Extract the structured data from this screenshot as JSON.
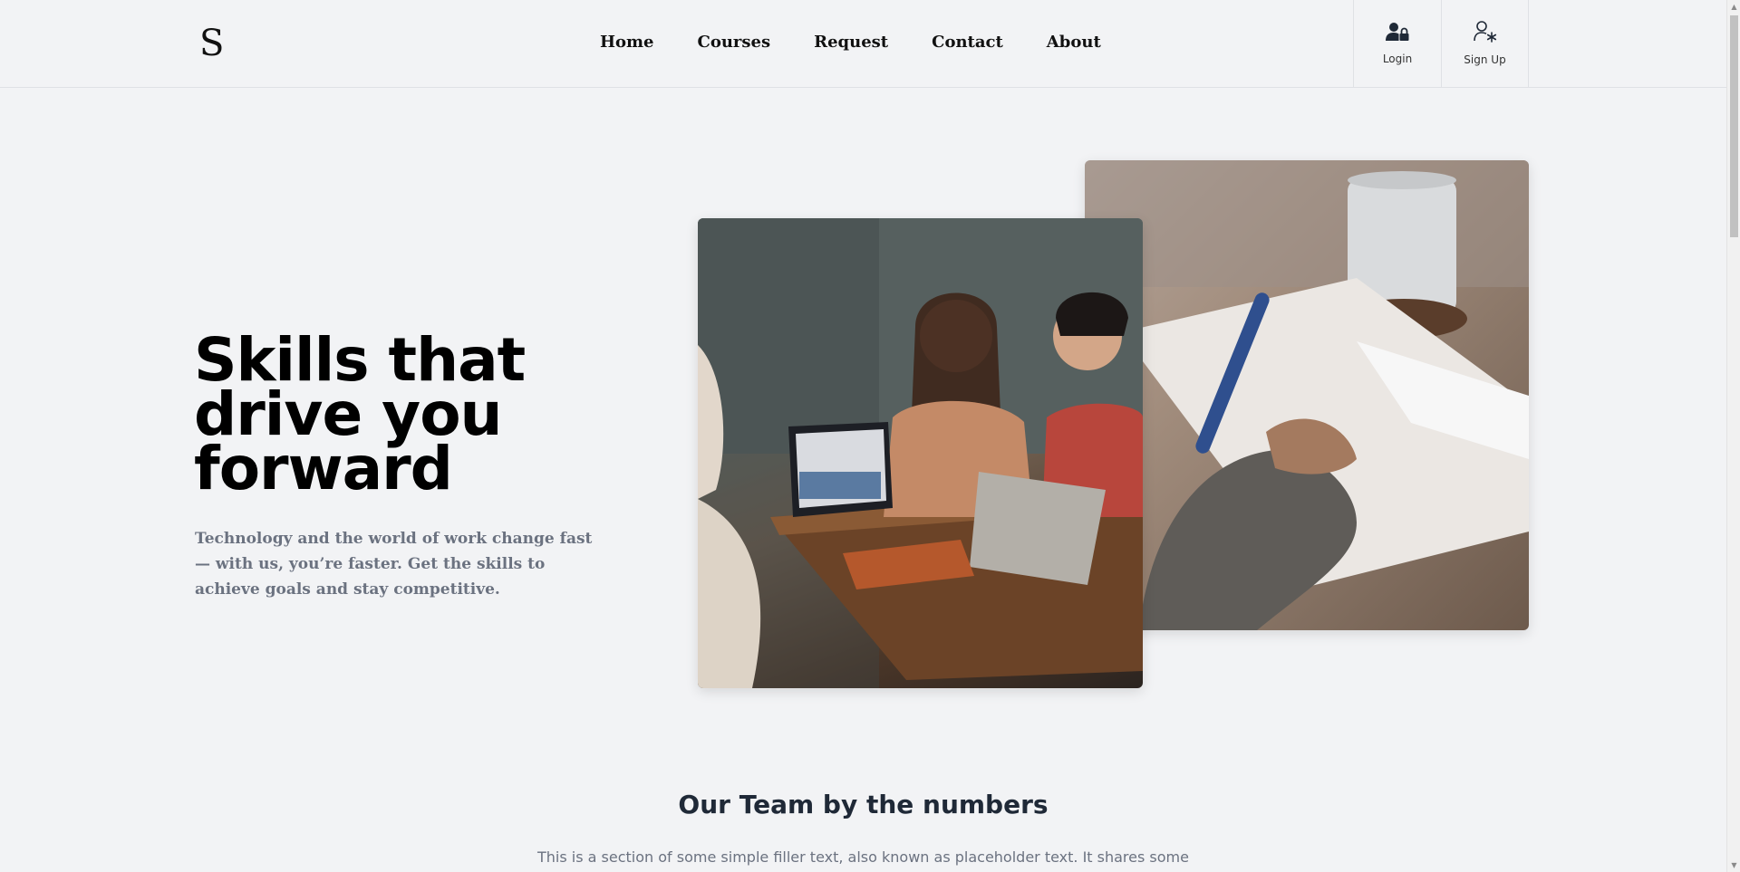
{
  "header": {
    "logo": "S",
    "nav": [
      "Home",
      "Courses",
      "Request",
      "Contact",
      "About"
    ],
    "login_label": "Login",
    "signup_label": "Sign Up"
  },
  "hero": {
    "title": "Skills that drive you forward",
    "text": "Technology and the world of work change fast — with us, you’re faster. Get the skills to achieve goals and stay competitive."
  },
  "section": {
    "title": "Our Team by the numbers",
    "text": "This is a section of some simple filler text, also known as placeholder text. It shares some"
  },
  "icons": {
    "login": "user-lock-icon",
    "signup": "user-asterisk-icon"
  },
  "colors": {
    "background": "#f2f3f5",
    "title": "#000000",
    "muted_text": "#6b7280"
  }
}
